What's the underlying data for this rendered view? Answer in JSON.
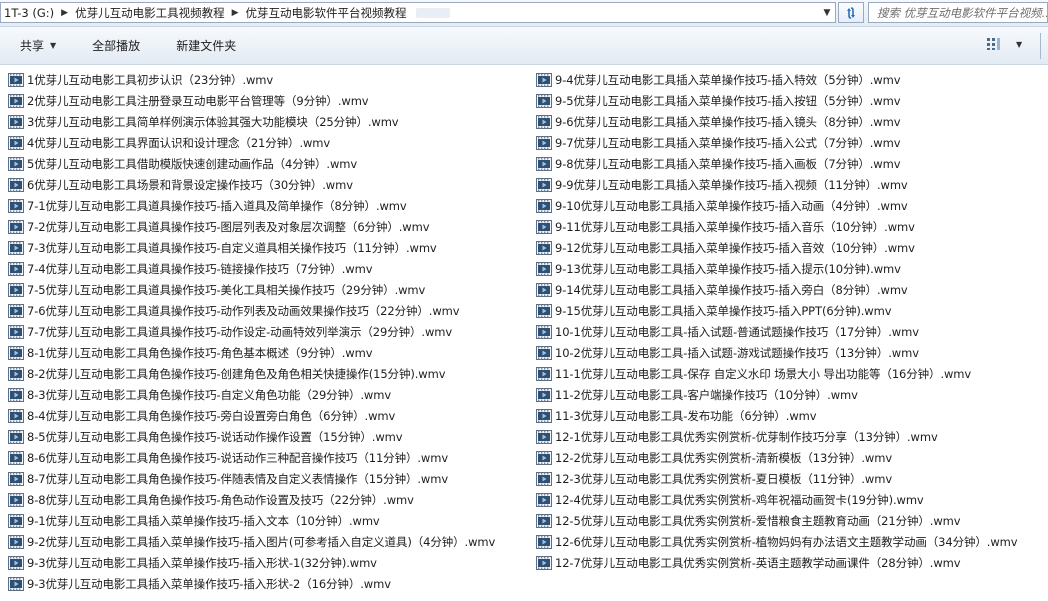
{
  "address_bar": {
    "crumbs": [
      "1T-3 (G:)",
      "优芽儿互动电影工具视频教程",
      "优芽互动电影软件平台视频教程"
    ]
  },
  "search": {
    "placeholder": "搜索 优芽互动电影软件平台视频..."
  },
  "toolbar": {
    "share_label": "共享",
    "play_all_label": "全部播放",
    "new_folder_label": "新建文件夹"
  },
  "files": {
    "left": [
      {
        "name": "1优芽儿互动电影工具初步认识（23分钟）.wmv"
      },
      {
        "name": "2优芽儿互动电影工具注册登录互动电影平台管理等（9分钟）.wmv"
      },
      {
        "name": "3优芽儿互动电影工具简单样例演示体验其强大功能模块（25分钟）.wmv"
      },
      {
        "name": "4优芽儿互动电影工具界面认识和设计理念（21分钟）.wmv"
      },
      {
        "name": "5优芽儿互动电影工具借助模版快速创建动画作品（4分钟）.wmv"
      },
      {
        "name": "6优芽儿互动电影工具场景和背景设定操作技巧（30分钟）.wmv"
      },
      {
        "name": "7-1优芽儿互动电影工具道具操作技巧-插入道具及简单操作（8分钟）.wmv"
      },
      {
        "name": "7-2优芽儿互动电影工具道具操作技巧-图层列表及对象层次调整（6分钟）.wmv"
      },
      {
        "name": "7-3优芽儿互动电影工具道具操作技巧-自定义道具相关操作技巧（11分钟）.wmv"
      },
      {
        "name": "7-4优芽儿互动电影工具道具操作技巧-链接操作技巧（7分钟）.wmv"
      },
      {
        "name": "7-5优芽儿互动电影工具道具操作技巧-美化工具相关操作技巧（29分钟）.wmv"
      },
      {
        "name": "7-6优芽儿互动电影工具道具操作技巧-动作列表及动画效果操作技巧（22分钟）.wmv"
      },
      {
        "name": "7-7优芽儿互动电影工具道具操作技巧-动作设定-动画特效列举演示（29分钟）.wmv"
      },
      {
        "name": "8-1优芽儿互动电影工具角色操作技巧-角色基本概述（9分钟）.wmv"
      },
      {
        "name": "8-2优芽儿互动电影工具角色操作技巧-创建角色及角色相关快捷操作(15分钟).wmv"
      },
      {
        "name": "8-3优芽儿互动电影工具角色操作技巧-自定义角色功能（29分钟）.wmv"
      },
      {
        "name": "8-4优芽儿互动电影工具角色操作技巧-旁白设置旁白角色（6分钟）.wmv"
      },
      {
        "name": "8-5优芽儿互动电影工具角色操作技巧-说话动作操作设置（15分钟）.wmv"
      },
      {
        "name": "8-6优芽儿互动电影工具角色操作技巧-说话动作三种配音操作技巧（11分钟）.wmv"
      },
      {
        "name": "8-7优芽儿互动电影工具角色操作技巧-伴随表情及自定义表情操作（15分钟）.wmv"
      },
      {
        "name": "8-8优芽儿互动电影工具角色操作技巧-角色动作设置及技巧（22分钟）.wmv"
      },
      {
        "name": "9-1优芽儿互动电影工具插入菜单操作技巧-插入文本（10分钟）.wmv"
      },
      {
        "name": "9-2优芽儿互动电影工具插入菜单操作技巧-插入图片(可参考插入自定义道具)（4分钟）.wmv"
      },
      {
        "name": "9-3优芽儿互动电影工具插入菜单操作技巧-插入形状-1(32分钟).wmv"
      },
      {
        "name": "9-3优芽儿互动电影工具插入菜单操作技巧-插入形状-2（16分钟）.wmv"
      }
    ],
    "right": [
      {
        "name": "9-4优芽儿互动电影工具插入菜单操作技巧-插入特效（5分钟）.wmv"
      },
      {
        "name": "9-5优芽儿互动电影工具插入菜单操作技巧-插入按钮（5分钟）.wmv"
      },
      {
        "name": "9-6优芽儿互动电影工具插入菜单操作技巧-插入镜头（8分钟）.wmv"
      },
      {
        "name": "9-7优芽儿互动电影工具插入菜单操作技巧-插入公式（7分钟）.wmv"
      },
      {
        "name": "9-8优芽儿互动电影工具插入菜单操作技巧-插入画板（7分钟）.wmv"
      },
      {
        "name": "9-9优芽儿互动电影工具插入菜单操作技巧-插入视频（11分钟）.wmv"
      },
      {
        "name": "9-10优芽儿互动电影工具插入菜单操作技巧-插入动画（4分钟）.wmv"
      },
      {
        "name": "9-11优芽儿互动电影工具插入菜单操作技巧-插入音乐（10分钟）.wmv"
      },
      {
        "name": "9-12优芽儿互动电影工具插入菜单操作技巧-插入音效（10分钟）.wmv"
      },
      {
        "name": "9-13优芽儿互动电影工具插入菜单操作技巧-插入提示(10分钟).wmv"
      },
      {
        "name": "9-14优芽儿互动电影工具插入菜单操作技巧-插入旁白（8分钟）.wmv"
      },
      {
        "name": "9-15优芽儿互动电影工具插入菜单操作技巧-插入PPT(6分钟).wmv"
      },
      {
        "name": "10-1优芽儿互动电影工具-插入试题-普通试题操作技巧（17分钟）.wmv"
      },
      {
        "name": "10-2优芽儿互动电影工具-插入试题-游戏试题操作技巧（13分钟）.wmv"
      },
      {
        "name": "11-1优芽儿互动电影工具-保存 自定义水印 场景大小 导出功能等（16分钟）.wmv"
      },
      {
        "name": "11-2优芽儿互动电影工具-客户端操作技巧（10分钟）.wmv"
      },
      {
        "name": "11-3优芽儿互动电影工具-发布功能（6分钟）.wmv"
      },
      {
        "name": "12-1优芽儿互动电影工具优秀实例赏析-优芽制作技巧分享（13分钟）.wmv"
      },
      {
        "name": "12-2优芽儿互动电影工具优秀实例赏析-清新模板（13分钟）.wmv"
      },
      {
        "name": "12-3优芽儿互动电影工具优秀实例赏析-夏日模板（11分钟）.wmv"
      },
      {
        "name": "12-4优芽儿互动电影工具优秀实例赏析-鸡年祝福动画贺卡(19分钟).wmv"
      },
      {
        "name": "12-5优芽儿互动电影工具优秀实例赏析-爱惜粮食主题教育动画（21分钟）.wmv"
      },
      {
        "name": "12-6优芽儿互动电影工具优秀实例赏析-植物妈妈有办法语文主题教学动画（34分钟）.wmv"
      },
      {
        "name": "12-7优芽儿互动电影工具优秀实例赏析-英语主题教学动画课件（28分钟）.wmv"
      }
    ]
  },
  "icons": {
    "file": "video-file-icon",
    "refresh": "refresh-icon",
    "view": "view-options-icon"
  },
  "colors": {
    "accent": "#3a6ea5",
    "text": "#1e1e1e",
    "toolbar_bg": "#e2eaf3"
  }
}
